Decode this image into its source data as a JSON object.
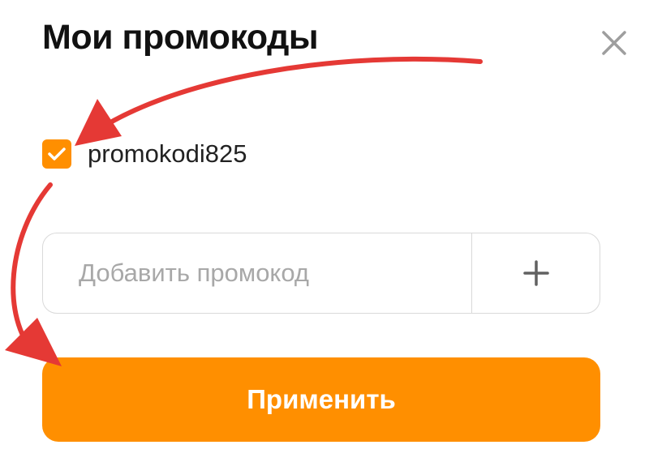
{
  "dialog": {
    "title": "Мои промокоды",
    "close_icon": "close-icon"
  },
  "promo_list": [
    {
      "code": "promokodi825",
      "checked": true
    }
  ],
  "add_promo": {
    "placeholder": "Добавить промокод",
    "value": "",
    "add_icon": "plus-icon"
  },
  "apply_button": {
    "label": "Применить"
  },
  "colors": {
    "accent": "#ff8f00",
    "annotation_arrow": "#e53935",
    "border": "#d9d9d9",
    "placeholder": "#a8a8a8"
  }
}
